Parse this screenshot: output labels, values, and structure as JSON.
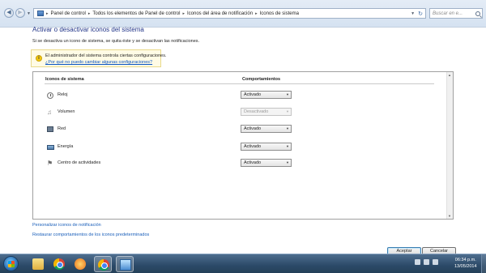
{
  "address_bar": {
    "breadcrumbs": [
      "Panel de control",
      "Todos los elementos de Panel de control",
      "Iconos del área de notificación",
      "Iconos de sistema"
    ],
    "search_placeholder": "Buscar en e..."
  },
  "main": {
    "title": "Activar o desactivar iconos del sistema",
    "description": "Si se desactiva un icono de sistema, se quita éste y se desactivan las notificaciones.",
    "info": {
      "text": "El administrador del sistema controla ciertas configuraciones.",
      "link": "¿Por qué no puedo cambiar algunas configuraciones?"
    },
    "table": {
      "col_icons": "Iconos de sistema",
      "col_behaviors": "Comportamientos",
      "rows": [
        {
          "label": "Reloj",
          "value": "Activado",
          "icon": "clock-icon",
          "disabled": false
        },
        {
          "label": "Volumen",
          "value": "Desactivado",
          "icon": "speaker-icon",
          "disabled": true
        },
        {
          "label": "Red",
          "value": "Activado",
          "icon": "network-icon",
          "disabled": false
        },
        {
          "label": "Energía",
          "value": "Activado",
          "icon": "battery-icon",
          "disabled": false
        },
        {
          "label": "Centro de actividades",
          "value": "Activado",
          "icon": "flag-icon",
          "disabled": false
        }
      ]
    },
    "links": {
      "customize": "Personalizar iconos de notificación",
      "restore": "Restaurar comportamientos de los iconos predeterminados"
    },
    "buttons": {
      "ok": "Aceptar",
      "cancel": "Cancelar"
    }
  },
  "taskbar": {
    "items": [
      "start-orb",
      "folder-icon",
      "chrome-icon",
      "media-player-icon",
      "chrome-icon",
      "control-panel-icon"
    ],
    "clock_time": "06:34 p.m.",
    "clock_date": "13/05/2014"
  }
}
